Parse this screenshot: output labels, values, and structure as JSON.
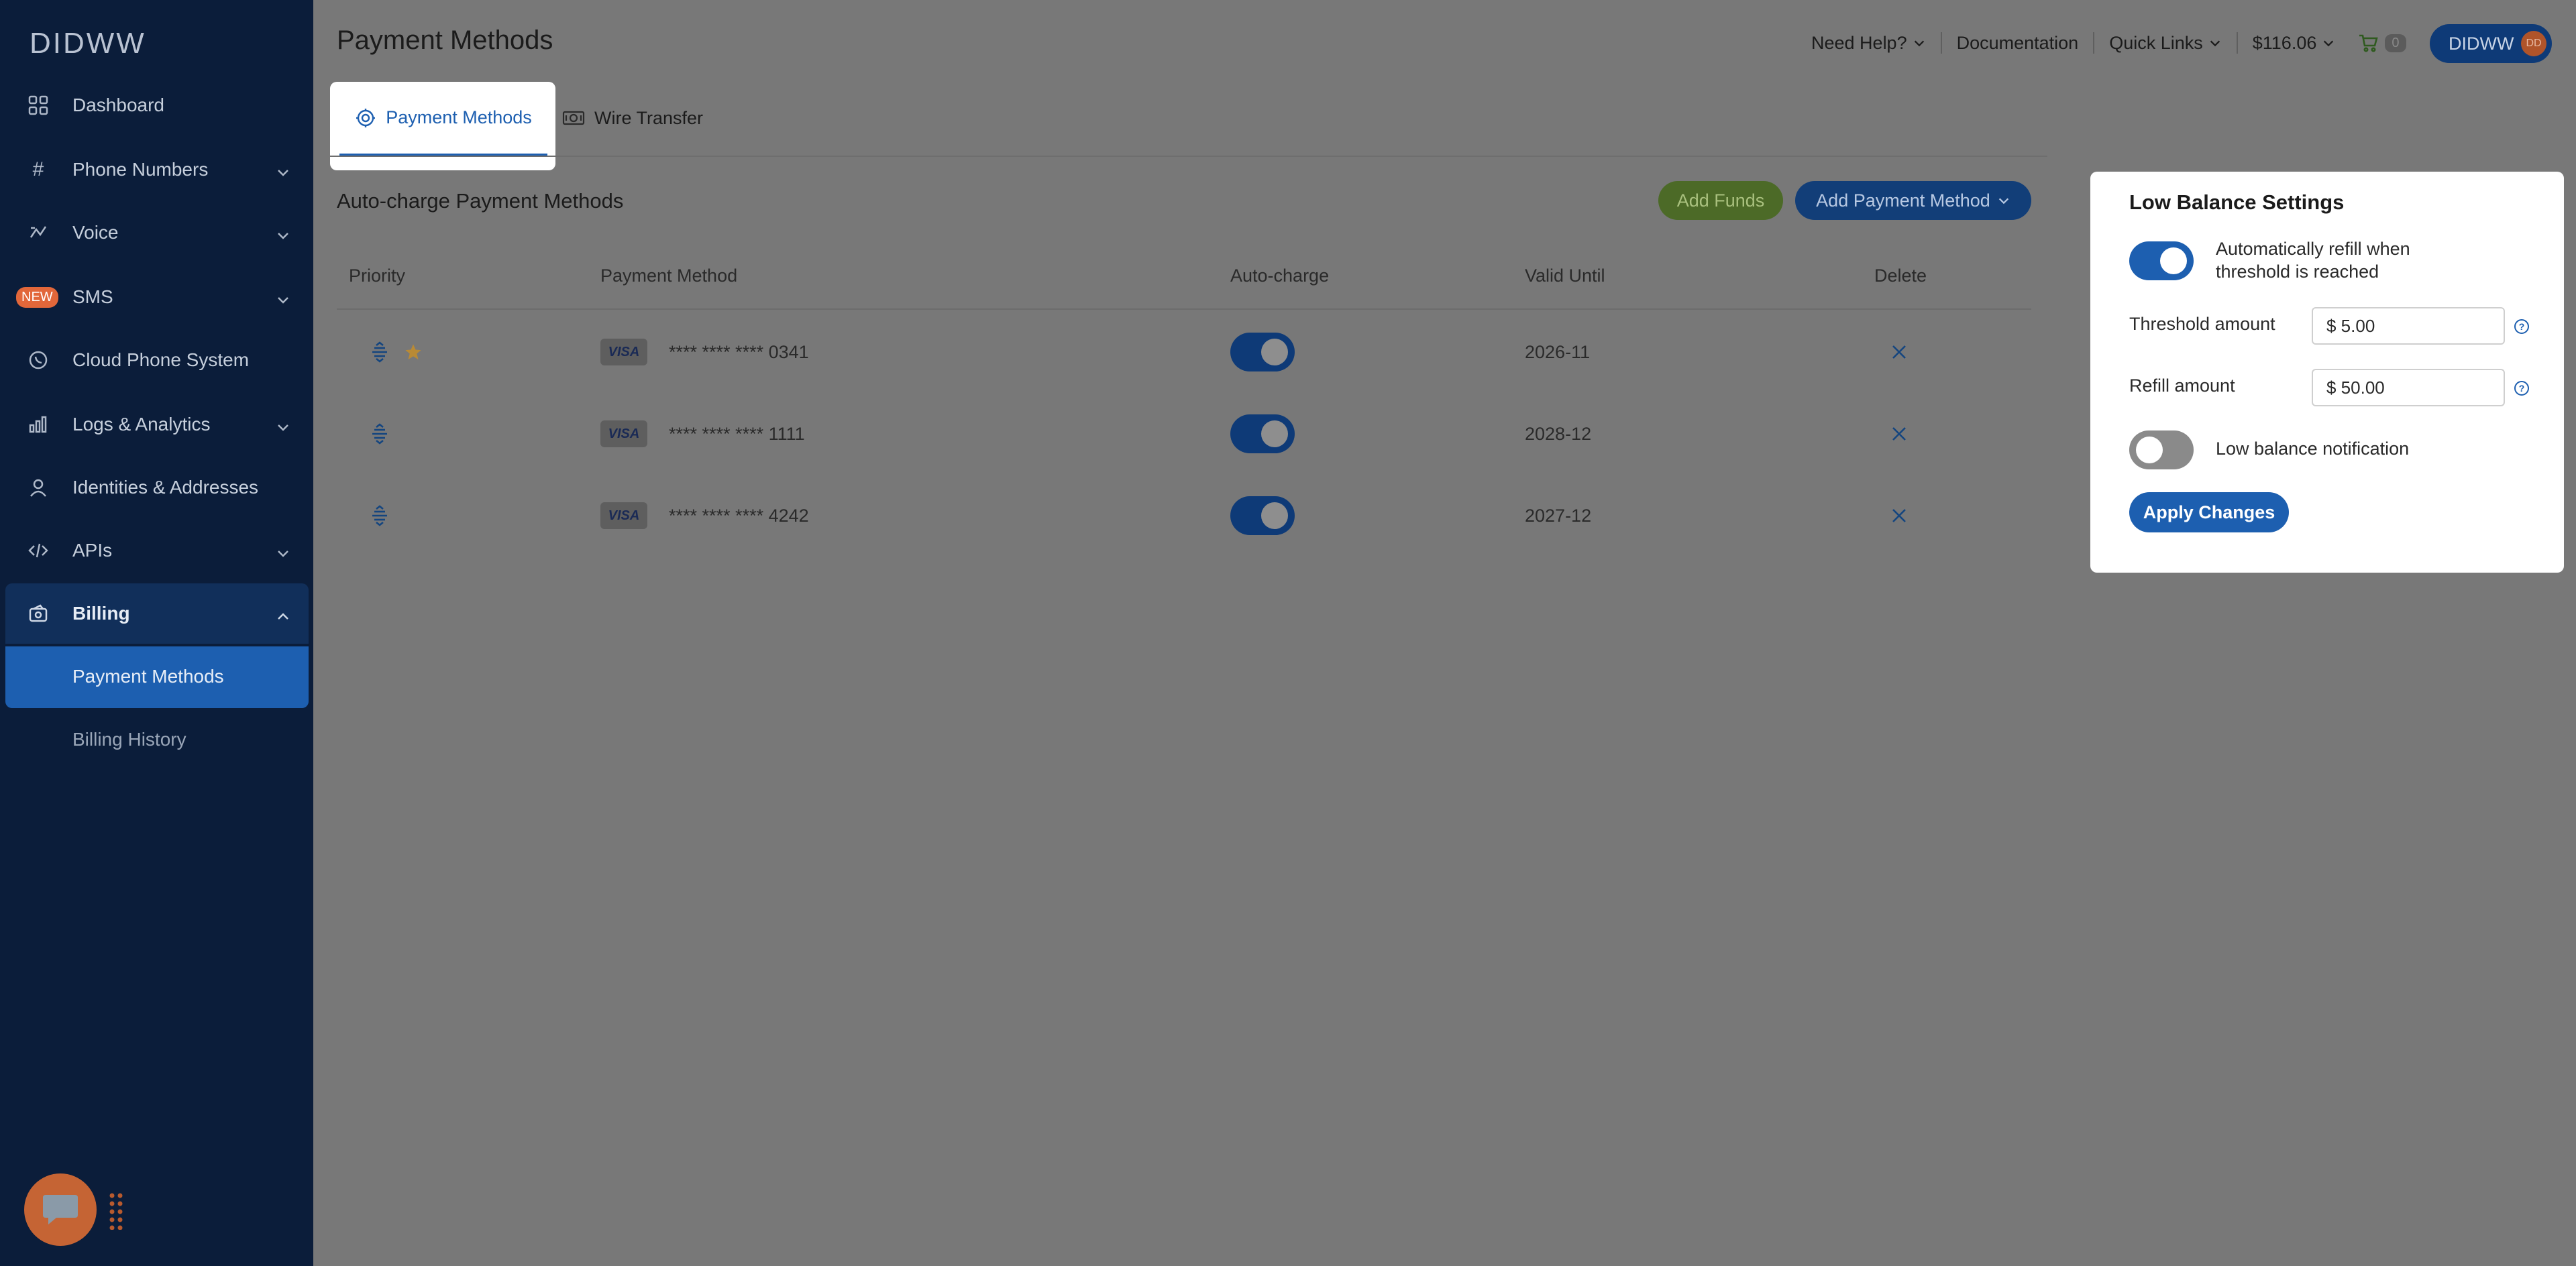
{
  "sidebar": {
    "logo": "DIDWW",
    "items": [
      {
        "label": "Dashboard"
      },
      {
        "label": "Phone Numbers"
      },
      {
        "label": "Voice"
      },
      {
        "label": "SMS",
        "badge": "NEW"
      },
      {
        "label": "Cloud Phone System"
      },
      {
        "label": "Logs & Analytics"
      },
      {
        "label": "Identities & Addresses"
      },
      {
        "label": "APIs"
      },
      {
        "label": "Billing"
      }
    ],
    "billing_sub": [
      {
        "label": "Payment Methods"
      },
      {
        "label": "Billing History"
      }
    ]
  },
  "header": {
    "title": "Payment Methods",
    "need_help": "Need Help?",
    "documentation": "Documentation",
    "quick_links": "Quick Links",
    "balance": "$116.06",
    "cart_count": "0",
    "user": "DIDWW",
    "avatar": "DD"
  },
  "tabs": [
    {
      "label": "Payment Methods"
    },
    {
      "label": "Wire Transfer"
    }
  ],
  "section": {
    "title": "Auto-charge Payment Methods",
    "add_funds": "Add Funds",
    "add_payment_method": "Add Payment Method"
  },
  "table": {
    "headers": [
      "Priority",
      "Payment Method",
      "Auto-charge",
      "Valid Until",
      "Delete"
    ],
    "rows": [
      {
        "brand": "VISA",
        "number": "**** **** **** 0341",
        "valid": "2026-11",
        "auto_charge": true,
        "primary": true
      },
      {
        "brand": "VISA",
        "number": "**** **** **** 1111",
        "valid": "2028-12",
        "auto_charge": true,
        "primary": false
      },
      {
        "brand": "VISA",
        "number": "**** **** **** 4242",
        "valid": "2027-12",
        "auto_charge": true,
        "primary": false
      }
    ]
  },
  "panel": {
    "title": "Low Balance Settings",
    "auto_refill_label_1": "Automatically refill when",
    "auto_refill_label_2": "threshold is reached",
    "threshold_label": "Threshold amount",
    "threshold_value": "$ 5.00",
    "refill_label": "Refill amount",
    "refill_value": "$ 50.00",
    "low_balance_label": "Low balance notification",
    "apply": "Apply Changes",
    "help": "?"
  },
  "colors": {
    "sidebar": "#0b1d3a",
    "accent": "#1d5fb0",
    "add_funds": "#4c6a27",
    "overlay": "#787878"
  }
}
